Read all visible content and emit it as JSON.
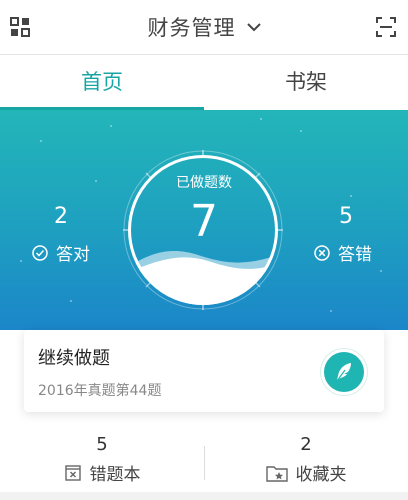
{
  "header": {
    "title": "财务管理",
    "icons": [
      "grid-icon",
      "chevron-down-icon",
      "scan-icon"
    ]
  },
  "tabs": [
    {
      "label": "首页",
      "active": true
    },
    {
      "label": "书架",
      "active": false
    }
  ],
  "summary": {
    "done_label": "已做题数",
    "done_count": "7",
    "correct_count": "2",
    "correct_label": "答对",
    "wrong_count": "5",
    "wrong_label": "答错"
  },
  "continue_card": {
    "title": "继续做题",
    "subtitle": "2016年真题第44题",
    "button_icon": "feather-icon"
  },
  "bottom_stats": [
    {
      "count": "5",
      "label": "错题本",
      "icon": "wrong-book-icon"
    },
    {
      "count": "2",
      "label": "收藏夹",
      "icon": "favorite-folder-icon"
    }
  ],
  "colors": {
    "accent": "#1aa5a5",
    "hero_top": "#23b6b9",
    "hero_bottom": "#1b86c9"
  }
}
